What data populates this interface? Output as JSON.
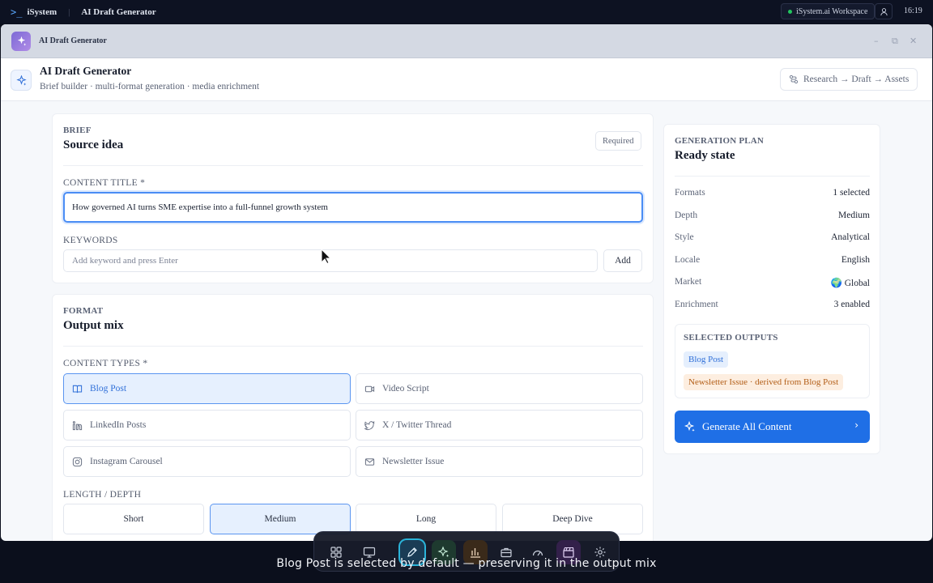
{
  "system_bar": {
    "brand": "iSystem",
    "app_name": "AI Draft Generator",
    "workspace": "iSystem.ai Workspace",
    "clock": "16:19"
  },
  "window": {
    "title": "AI Draft Generator"
  },
  "header": {
    "title": "AI Draft Generator",
    "subtitle": "Brief builder · multi-format generation · media enrichment",
    "pipeline": "Research → Draft → Assets"
  },
  "brief": {
    "eyebrow": "BRIEF",
    "title": "Source idea",
    "required_badge": "Required",
    "content_title_label": "CONTENT TITLE *",
    "content_title_value": "How governed AI turns SME expertise into a full-funnel growth system",
    "keywords_label": "KEYWORDS",
    "keywords_placeholder": "Add keyword and press Enter",
    "add_button": "Add"
  },
  "format": {
    "eyebrow": "FORMAT",
    "title": "Output mix",
    "content_types_label": "CONTENT TYPES *",
    "content_types": [
      {
        "label": "Blog Post",
        "icon": "book-icon",
        "selected": true
      },
      {
        "label": "Video Script",
        "icon": "video-icon",
        "selected": false
      },
      {
        "label": "LinkedIn Posts",
        "icon": "linkedin-icon",
        "selected": false
      },
      {
        "label": "X / Twitter Thread",
        "icon": "twitter-icon",
        "selected": false
      },
      {
        "label": "Instagram Carousel",
        "icon": "instagram-icon",
        "selected": false
      },
      {
        "label": "Newsletter Issue",
        "icon": "mail-icon",
        "selected": false
      }
    ],
    "depth_label": "LENGTH / DEPTH",
    "depth_options": [
      {
        "label": "Short",
        "selected": false
      },
      {
        "label": "Medium",
        "selected": true
      },
      {
        "label": "Long",
        "selected": false
      },
      {
        "label": "Deep Dive",
        "selected": false
      }
    ]
  },
  "plan": {
    "eyebrow": "GENERATION PLAN",
    "title": "Ready state",
    "rows": [
      {
        "key": "Formats",
        "value": "1 selected"
      },
      {
        "key": "Depth",
        "value": "Medium"
      },
      {
        "key": "Style",
        "value": "Analytical"
      },
      {
        "key": "Locale",
        "value": "English"
      },
      {
        "key": "Market",
        "value": "🌍 Global"
      },
      {
        "key": "Enrichment",
        "value": "3 enabled"
      }
    ],
    "selected_outputs_label": "SELECTED OUTPUTS",
    "outputs": [
      {
        "label": "Blog Post"
      },
      {
        "label": "Newsletter Issue · derived from Blog Post"
      }
    ],
    "generate_button": "Generate All Content"
  },
  "dock": {
    "items": [
      "grid-icon",
      "monitor-icon",
      "pen-icon",
      "sparkle-icon",
      "chart-icon",
      "briefcase-icon",
      "gauge-icon",
      "clapper-icon",
      "gear-icon"
    ],
    "active": "pen-icon"
  },
  "caption": "Blog Post is selected by default — preserving it in the output mix"
}
